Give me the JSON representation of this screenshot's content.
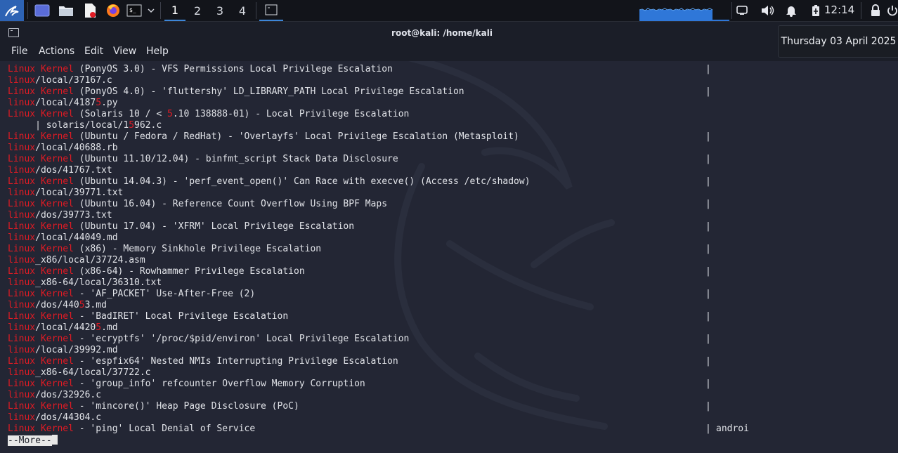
{
  "panel": {
    "workspaces": [
      "1",
      "2",
      "3",
      "4"
    ],
    "active_workspace": "1",
    "clock": "12:14"
  },
  "window": {
    "title": "root@kali: /home/kali"
  },
  "menubar": {
    "items": [
      "File",
      "Actions",
      "Edit",
      "View",
      "Help"
    ]
  },
  "date_popup": "Thursday 03 April 2025",
  "terminal": {
    "lines": [
      {
        "segments": [
          [
            "Linux Kernel",
            "r"
          ],
          [
            " (PonyOS 3.0) - VFS Permissions Local Privilege Escalation",
            "w"
          ]
        ],
        "pipe": "|"
      },
      {
        "segments": [
          [
            "linux",
            "r"
          ],
          [
            "/local/37167.c",
            "w"
          ]
        ]
      },
      {
        "segments": [
          [
            "Linux Kernel",
            "r"
          ],
          [
            " (PonyOS 4.0) - 'fluttershy' LD_LIBRARY_PATH Local Privilege Escalation",
            "w"
          ]
        ],
        "pipe": "|"
      },
      {
        "segments": [
          [
            "linux",
            "r"
          ],
          [
            "/local/4187",
            "w"
          ],
          [
            "5",
            "r"
          ],
          [
            ".py",
            "w"
          ]
        ]
      },
      {
        "segments": [
          [
            "Linux Kernel",
            "r"
          ],
          [
            " (Solaris 10 / < ",
            "w"
          ],
          [
            "5",
            "r"
          ],
          [
            ".10 138888-01) - Local Privilege Escalation",
            "w"
          ]
        ]
      },
      {
        "segments": [
          [
            "     | solaris/local/1",
            "w"
          ],
          [
            "5",
            "r"
          ],
          [
            "962.c",
            "w"
          ]
        ]
      },
      {
        "segments": [
          [
            "Linux Kernel",
            "r"
          ],
          [
            " (Ubuntu / Fedora / RedHat) - 'Overlayfs' Local Privilege Escalation (Metasploit)",
            "w"
          ]
        ],
        "pipe": "|"
      },
      {
        "segments": [
          [
            "linux",
            "r"
          ],
          [
            "/local/40688.rb",
            "w"
          ]
        ]
      },
      {
        "segments": [
          [
            "Linux Kernel",
            "r"
          ],
          [
            " (Ubuntu 11.10/12.04) - binfmt_script Stack Data Disclosure",
            "w"
          ]
        ],
        "pipe": "|"
      },
      {
        "segments": [
          [
            "linux",
            "r"
          ],
          [
            "/dos/41767.txt",
            "w"
          ]
        ]
      },
      {
        "segments": [
          [
            "Linux Kernel",
            "r"
          ],
          [
            " (Ubuntu 14.04.3) - 'perf_event_open()' Can Race with execve() (Access /etc/shadow)",
            "w"
          ]
        ],
        "pipe": "|"
      },
      {
        "segments": [
          [
            "linux",
            "r"
          ],
          [
            "/local/39771.txt",
            "w"
          ]
        ]
      },
      {
        "segments": [
          [
            "Linux Kernel",
            "r"
          ],
          [
            " (Ubuntu 16.04) - Reference Count Overflow Using BPF Maps",
            "w"
          ]
        ],
        "pipe": "|"
      },
      {
        "segments": [
          [
            "linux",
            "r"
          ],
          [
            "/dos/39773.txt",
            "w"
          ]
        ]
      },
      {
        "segments": [
          [
            "Linux Kernel",
            "r"
          ],
          [
            " (Ubuntu 17.04) - 'XFRM' Local Privilege Escalation",
            "w"
          ]
        ],
        "pipe": "|"
      },
      {
        "segments": [
          [
            "linux",
            "r"
          ],
          [
            "/local/44049.md",
            "w"
          ]
        ]
      },
      {
        "segments": [
          [
            "Linux Kernel",
            "r"
          ],
          [
            " (x86) - Memory Sinkhole Privilege Escalation",
            "w"
          ]
        ],
        "pipe": "|"
      },
      {
        "segments": [
          [
            "linux",
            "r"
          ],
          [
            "_x86/local/37724.asm",
            "w"
          ]
        ]
      },
      {
        "segments": [
          [
            "Linux Kernel",
            "r"
          ],
          [
            " (x86-64) - Rowhammer Privilege Escalation",
            "w"
          ]
        ],
        "pipe": "|"
      },
      {
        "segments": [
          [
            "linux",
            "r"
          ],
          [
            "_x86-64/local/36310.txt",
            "w"
          ]
        ]
      },
      {
        "segments": [
          [
            "Linux Kernel",
            "r"
          ],
          [
            " - 'AF_PACKET' Use-After-Free (2)",
            "w"
          ]
        ],
        "pipe": "|"
      },
      {
        "segments": [
          [
            "linux",
            "r"
          ],
          [
            "/dos/440",
            "w"
          ],
          [
            "5",
            "r"
          ],
          [
            "3.md",
            "w"
          ]
        ]
      },
      {
        "segments": [
          [
            "Linux Kernel",
            "r"
          ],
          [
            " - 'BadIRET' Local Privilege Escalation",
            "w"
          ]
        ],
        "pipe": "|"
      },
      {
        "segments": [
          [
            "linux",
            "r"
          ],
          [
            "/local/4420",
            "w"
          ],
          [
            "5",
            "r"
          ],
          [
            ".md",
            "w"
          ]
        ]
      },
      {
        "segments": [
          [
            "Linux Kernel",
            "r"
          ],
          [
            " - 'ecryptfs' '/proc/$pid/environ' Local Privilege Escalation",
            "w"
          ]
        ],
        "pipe": "|"
      },
      {
        "segments": [
          [
            "linux",
            "r"
          ],
          [
            "/local/39992.md",
            "w"
          ]
        ]
      },
      {
        "segments": [
          [
            "Linux Kernel",
            "r"
          ],
          [
            " - 'espfix64' Nested NMIs Interrupting Privilege Escalation",
            "w"
          ]
        ],
        "pipe": "|"
      },
      {
        "segments": [
          [
            "linux",
            "r"
          ],
          [
            "_x86-64/local/37722.c",
            "w"
          ]
        ]
      },
      {
        "segments": [
          [
            "Linux Kernel",
            "r"
          ],
          [
            " - 'group_info' refcounter Overflow Memory Corruption",
            "w"
          ]
        ],
        "pipe": "|"
      },
      {
        "segments": [
          [
            "linux",
            "r"
          ],
          [
            "/dos/32926.c",
            "w"
          ]
        ]
      },
      {
        "segments": [
          [
            "Linux Kernel",
            "r"
          ],
          [
            " - 'mincore()' Heap Page Disclosure (PoC)",
            "w"
          ]
        ],
        "pipe": "|"
      },
      {
        "segments": [
          [
            "linux",
            "r"
          ],
          [
            "/dos/44304.c",
            "w"
          ]
        ]
      },
      {
        "segments": [
          [
            "Linux Kernel",
            "r"
          ],
          [
            " - 'ping' Local Denial of Service",
            "w"
          ]
        ],
        "pipe": "|",
        "extra": "androi"
      }
    ],
    "pager_prompt": "--More--"
  },
  "colors": {
    "highlight_red": "#e01b24",
    "terminal_bg": "#232634",
    "accent_blue": "#3d86d8"
  },
  "icons": {
    "launcher": "kali-dragon-icon",
    "desktop": "show-desktop-icon",
    "files": "file-manager-icon",
    "editor": "text-editor-icon",
    "browser": "firefox-icon",
    "terminal": "terminal-icon",
    "network": "network-icon",
    "volume": "volume-icon",
    "notifications": "bell-icon",
    "battery": "battery-icon",
    "lock": "lock-icon"
  }
}
